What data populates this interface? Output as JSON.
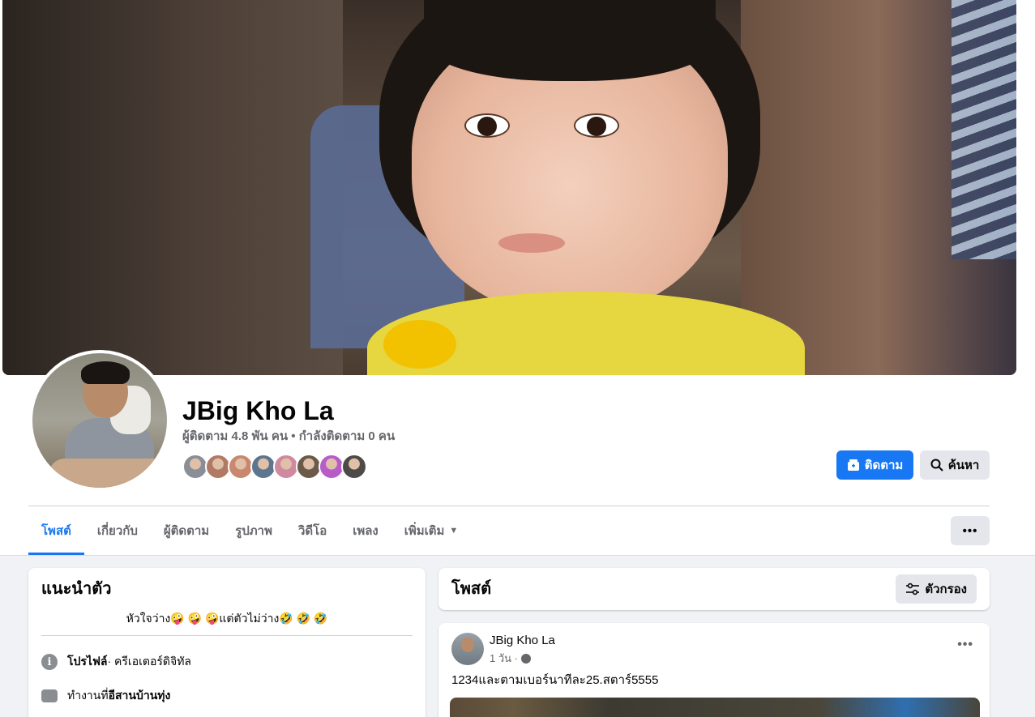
{
  "profile": {
    "name": "JBig Kho La",
    "stats": "ผู้ติดตาม 4.8 พัน คน • กำลังติดตาม 0 คน"
  },
  "actions": {
    "follow_label": "ติดตาม",
    "search_label": "ค้นหา",
    "more_label": "•••"
  },
  "tabs": [
    {
      "label": "โพสต์",
      "active": true
    },
    {
      "label": "เกี่ยวกับ"
    },
    {
      "label": "ผู้ติดตาม"
    },
    {
      "label": "รูปภาพ"
    },
    {
      "label": "วิดีโอ"
    },
    {
      "label": "เพลง"
    },
    {
      "label": "เพิ่มเติม"
    }
  ],
  "follower_avatars": [
    "#8a8f97",
    "#b07a64",
    "#c9886e",
    "#5d7690",
    "#d08aa0",
    "#6b5a4a",
    "#b85dc8",
    "#4e4a48"
  ],
  "intro": {
    "title": "แนะนำตัว",
    "bio": "หัวใจว่าง🤪 🤪 🤪แต่ตัวไม่ว่าง🤣 🤣 🤣",
    "profile_label": "โปรไฟล์",
    "profile_value": " · ครีเอเตอร์ดิจิทัล",
    "work_prefix": "ทำงานที่ ",
    "work_value": "อีสานบ้านทุ่ง"
  },
  "posts": {
    "title": "โพสต์",
    "filter_label": "ตัวกรอง",
    "items": [
      {
        "author": "JBig Kho La",
        "time": "1 วัน ·",
        "text": "1234และตามเบอร์นาทีละ25.สตาร์5555"
      }
    ]
  },
  "colors": {
    "accent": "#1877f2",
    "background": "#f0f2f5",
    "button_gray": "#e4e6eb",
    "muted_text": "#65676b"
  }
}
